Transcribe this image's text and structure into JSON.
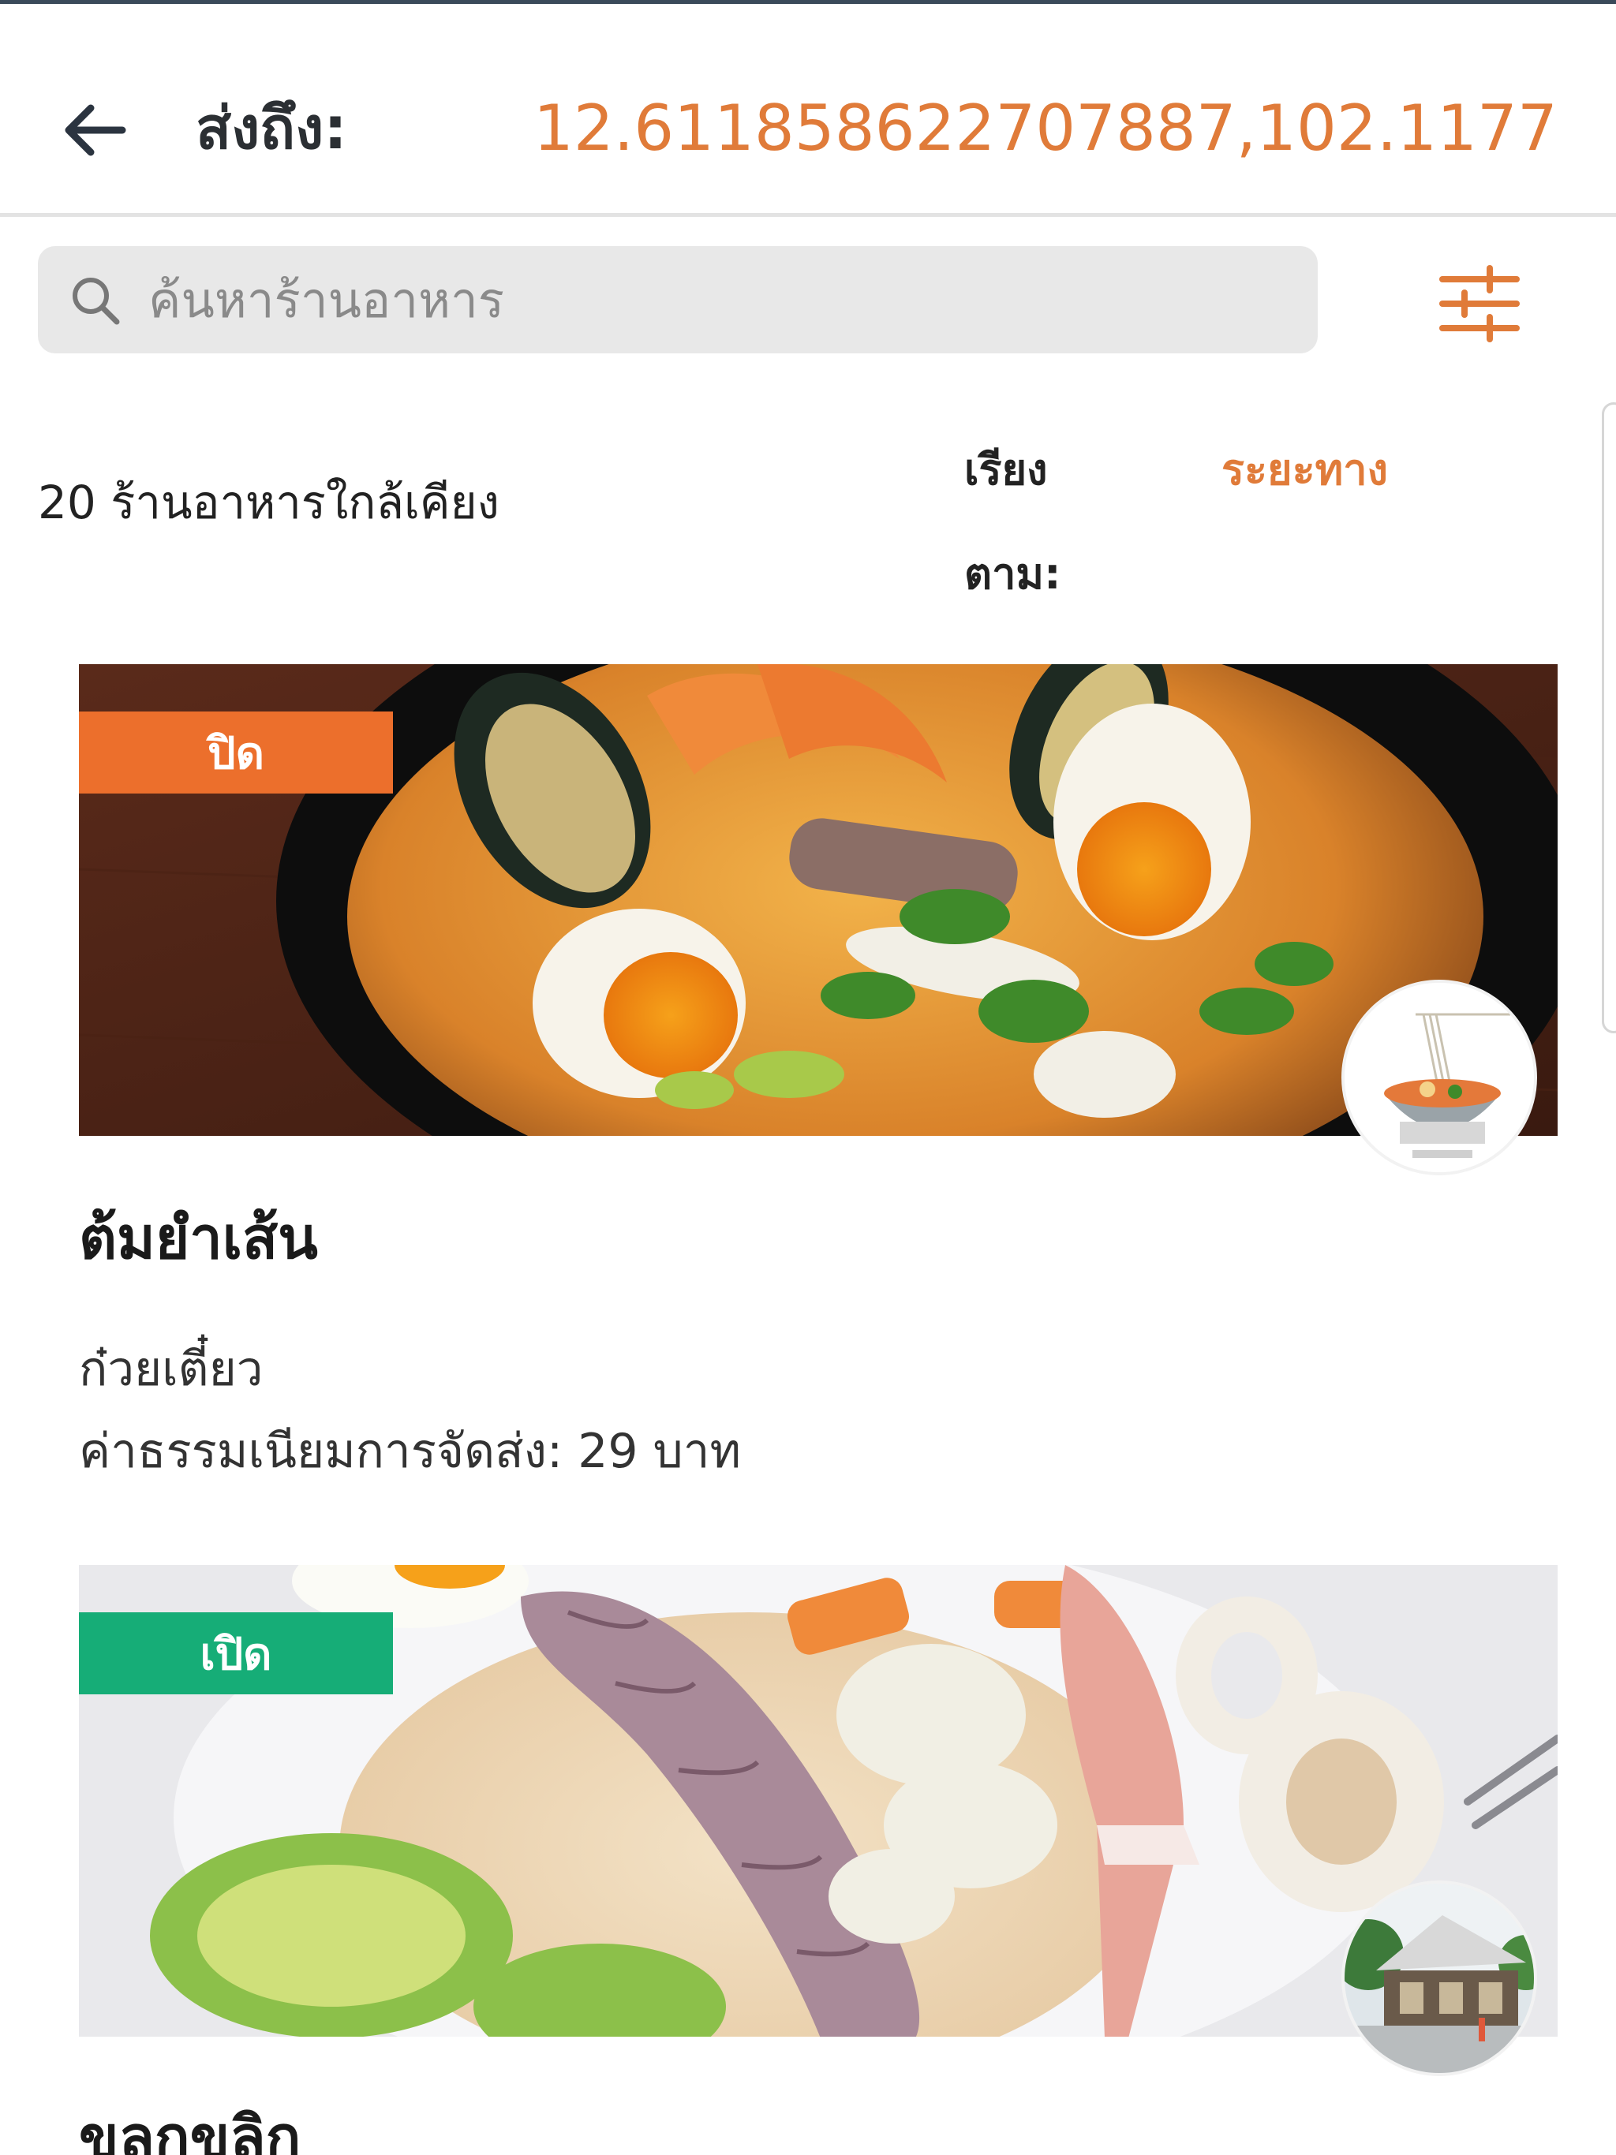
{
  "header": {
    "deliver_label": "ส่งถึง:",
    "deliver_value": "12.611858622707887,102.1177"
  },
  "search": {
    "placeholder": "ค้นหาร้านอาหาร"
  },
  "list": {
    "count_text": "20 ร้านอาหารใกล้เคียง",
    "sort_label": "เรียงตาม:",
    "sort_value": "ระยะทาง"
  },
  "restaurants": [
    {
      "status": "ปิด",
      "name": "ต้มยำเส้น",
      "category": "ก๋วยเตี๋ยว",
      "fee": "ค่าธรรมเนียมการจัดส่ง: 29 บาท"
    },
    {
      "status": "เปิด",
      "name": "ขลุกขลิก"
    }
  ],
  "colors": {
    "accent": "#e07b39",
    "closed": "#ec6f2c",
    "open": "#16ad77"
  },
  "icons": {
    "back": "arrow-left-icon",
    "search": "search-icon",
    "filter": "sliders-icon"
  }
}
